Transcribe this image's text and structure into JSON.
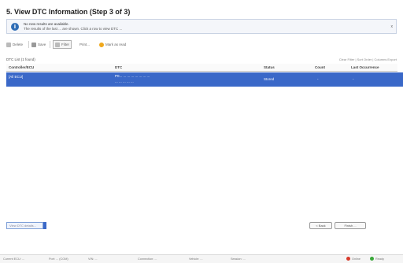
{
  "title": "5. View DTC Information (Step 3 of 3)",
  "info": {
    "line1": "No new results are available.",
    "line2": "The results of the last ... are shown.  Click a row to view DTC ...",
    "close": "x"
  },
  "toolbar": {
    "delete": "Delete",
    "save": "Save",
    "filter": "Filter",
    "print": "Print...",
    "marked": "Mark as read"
  },
  "grid": {
    "count_label": "DTC List (1 found)",
    "tools": "Clear Filter   |   Sort Order   |   Columns   Export",
    "columns": [
      "Controller/ECU",
      "DTC",
      "Status",
      "Count",
      "Last Occurrence"
    ],
    "rows": [
      {
        "ecu": "[All ECU]",
        "dtc_line1": "P0... ... ... ... ... ... ... ...",
        "dtc_line2": "... ... ... ... ...",
        "status": "Stored",
        "count": "-",
        "last": "-"
      }
    ]
  },
  "bottom": {
    "view_field": "View DTC details...",
    "back": "< Back",
    "next": "Finish ..."
  },
  "status_bar": {
    "items": [
      "Current ECU: ...",
      "Port: ...  (COM)",
      "VIN: ...",
      "Connection: ...",
      "Vehicle: ...",
      "Session: ..."
    ],
    "right1": "Online",
    "right2": "Ready"
  },
  "colors": {
    "selected_row": "#3a68c8",
    "info_icon": "#2f6db5",
    "status_red": "#d83a2a",
    "status_green": "#3aa83a"
  }
}
